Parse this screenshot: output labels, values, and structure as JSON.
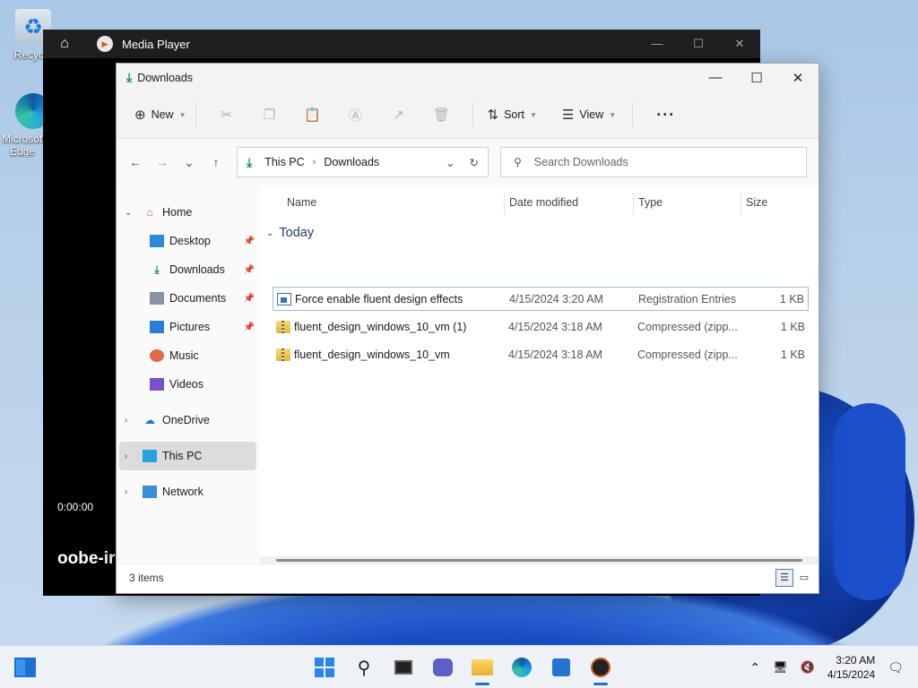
{
  "desktop": {
    "icons": [
      {
        "label": "Recycle",
        "icon": "recycle-bin-icon"
      },
      {
        "label": "Microsoft Edge",
        "icon": "edge-icon"
      }
    ]
  },
  "media_player": {
    "title": "Media Player",
    "time": "0:00:00",
    "now_playing": "oobe-ir"
  },
  "explorer": {
    "title": "Downloads",
    "toolbar": {
      "new_label": "New",
      "sort_label": "Sort",
      "view_label": "View",
      "more_label": "···"
    },
    "address": {
      "crumbs": [
        "This PC",
        "Downloads"
      ]
    },
    "search": {
      "placeholder": "Search Downloads"
    },
    "sidebar": {
      "home": "Home",
      "pinned": [
        "Desktop",
        "Downloads",
        "Documents",
        "Pictures"
      ],
      "unpinned": [
        "Music",
        "Videos"
      ],
      "onedrive": "OneDrive",
      "this_pc": "This PC",
      "network": "Network"
    },
    "columns": {
      "name": "Name",
      "date": "Date modified",
      "type": "Type",
      "size": "Size"
    },
    "group": "Today",
    "files": [
      {
        "name": "Force enable fluent design effects",
        "date": "4/15/2024 3:20 AM",
        "type": "Registration Entries",
        "size": "1 KB",
        "icon": "registry-file-icon"
      },
      {
        "name": "fluent_design_windows_10_vm (1)",
        "date": "4/15/2024 3:18 AM",
        "type": "Compressed (zipp...",
        "size": "1 KB",
        "icon": "zip-folder-icon"
      },
      {
        "name": "fluent_design_windows_10_vm",
        "date": "4/15/2024 3:18 AM",
        "type": "Compressed (zipp...",
        "size": "1 KB",
        "icon": "zip-folder-icon"
      }
    ],
    "status": "3 items"
  },
  "taskbar": {
    "time": "3:20 AM",
    "date": "4/15/2024"
  }
}
